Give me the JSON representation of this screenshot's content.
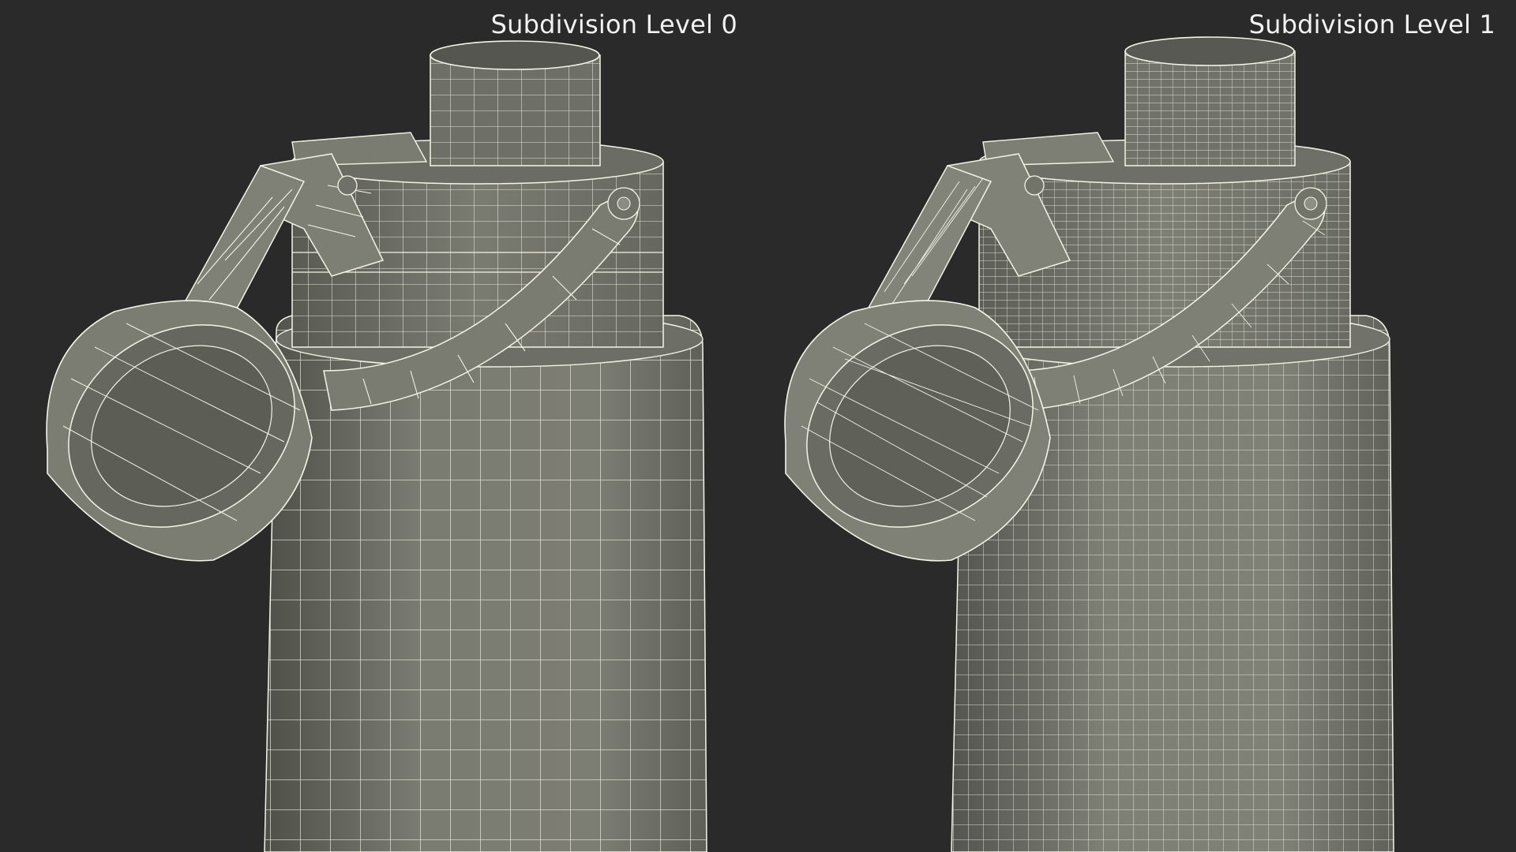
{
  "viewport": {
    "background_color": "#2a2a2a",
    "model_color": "#74756b",
    "wire_color": "#f4f4e6"
  },
  "panels": [
    {
      "label": "Subdivision Level 0",
      "density": "coarse"
    },
    {
      "label": "Subdivision Level 1",
      "density": "fine"
    }
  ]
}
